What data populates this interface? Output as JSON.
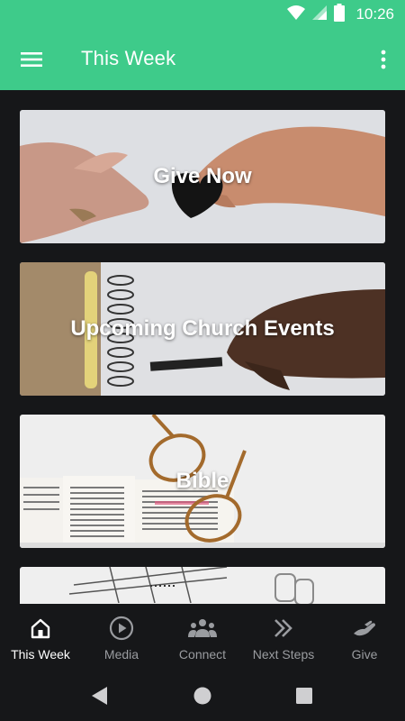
{
  "status_bar": {
    "time": "10:26",
    "icons": [
      "wifi-icon",
      "signal-icon",
      "battery-icon"
    ]
  },
  "app_bar": {
    "title": "This Week",
    "menu_icon": "hamburger-menu-icon",
    "overflow_icon": "more-vert-icon"
  },
  "cards": [
    {
      "label": "Give Now",
      "image": "hands-passing-heart"
    },
    {
      "label": "Upcoming Church Events",
      "image": "hand-on-notebook"
    },
    {
      "label": "Bible",
      "image": "glasses-on-open-bible"
    },
    {
      "label": "",
      "image": "calendar-and-paperclip"
    }
  ],
  "bottom_nav": {
    "items": [
      {
        "label": "This Week",
        "icon": "home-icon",
        "active": true
      },
      {
        "label": "Media",
        "icon": "play-circle-icon",
        "active": false
      },
      {
        "label": "Connect",
        "icon": "people-group-icon",
        "active": false
      },
      {
        "label": "Next Steps",
        "icon": "double-chevron-icon",
        "active": false
      },
      {
        "label": "Give",
        "icon": "giving-hand-icon",
        "active": false
      }
    ]
  },
  "system_nav": {
    "back_icon": "back-triangle-icon",
    "home_icon": "home-circle-icon",
    "recents_icon": "recents-square-icon"
  },
  "colors": {
    "accent": "#3ecb8a",
    "background": "#161719",
    "nav_inactive": "#9a9ca0",
    "nav_active": "#ffffff"
  }
}
